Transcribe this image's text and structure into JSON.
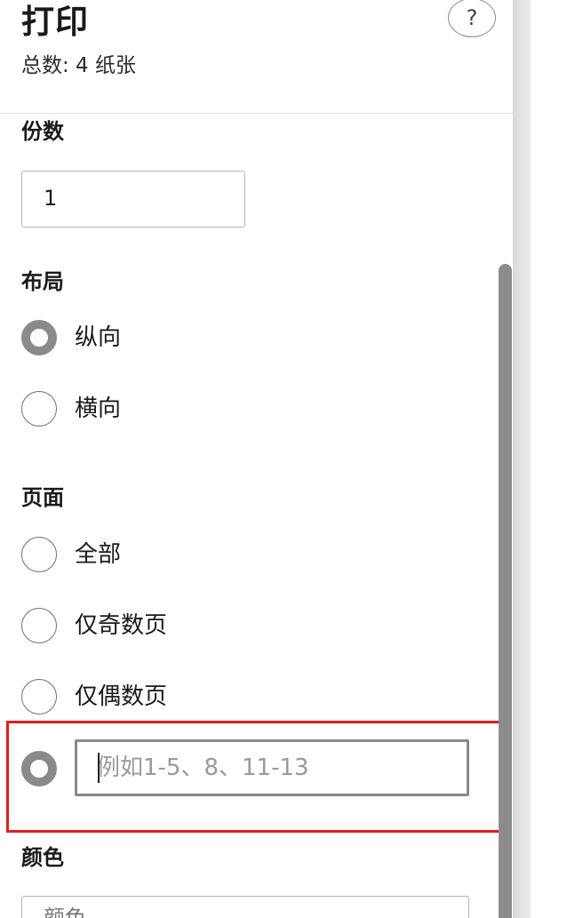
{
  "header": {
    "title": "打印",
    "subtitle": "总数: 4 纸张",
    "help_label": "?"
  },
  "copies": {
    "label": "份数",
    "value": "1"
  },
  "layout": {
    "label": "布局",
    "options": [
      {
        "label": "纵向",
        "selected": true
      },
      {
        "label": "横向",
        "selected": false
      }
    ]
  },
  "pages": {
    "label": "页面",
    "options": [
      {
        "label": "全部",
        "selected": false
      },
      {
        "label": "仅奇数页",
        "selected": false
      },
      {
        "label": "仅偶数页",
        "selected": false
      }
    ],
    "custom": {
      "selected": true,
      "placeholder": "例如1-5、8、11-13"
    }
  },
  "color": {
    "label": "颜色",
    "value": "颜色"
  },
  "colors": {
    "highlight_box": "#e11d1d",
    "radio_checked": "#8a8a8a",
    "scrollbar": "#8c8c8c"
  }
}
